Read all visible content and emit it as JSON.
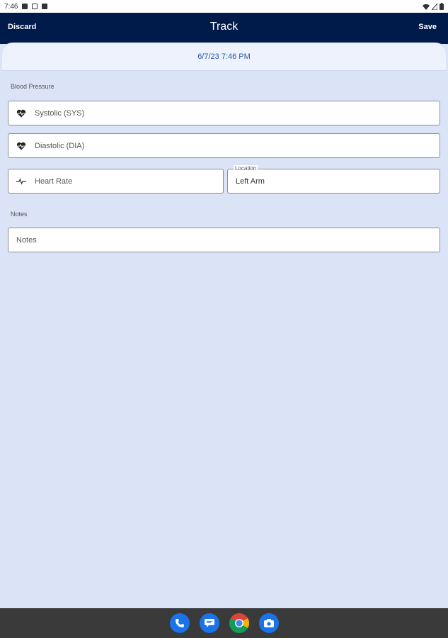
{
  "status_bar": {
    "time": "7:46"
  },
  "app_bar": {
    "discard_label": "Discard",
    "title": "Track",
    "save_label": "Save"
  },
  "date_time": "6/7/23 7:46 PM",
  "blood_pressure": {
    "section_label": "Blood Pressure",
    "systolic_placeholder": "Systolic (SYS)",
    "diastolic_placeholder": "Diastolic (DIA)",
    "heart_rate_placeholder": "Heart Rate",
    "location_label": "Location",
    "location_value": "Left Arm"
  },
  "notes": {
    "section_label": "Notes",
    "placeholder": "Notes"
  },
  "icons": {
    "systolic": "heart-pulse-icon",
    "diastolic": "heart-pulse-icon",
    "heart_rate": "pulse-line-icon",
    "dock": [
      "phone-icon",
      "messages-icon",
      "chrome-icon",
      "camera-icon"
    ]
  },
  "colors": {
    "app_bar": "#001a4a",
    "background": "#dbe3f7",
    "accent_text": "#2d58a8",
    "nav_bar": "#3a3a3a"
  }
}
